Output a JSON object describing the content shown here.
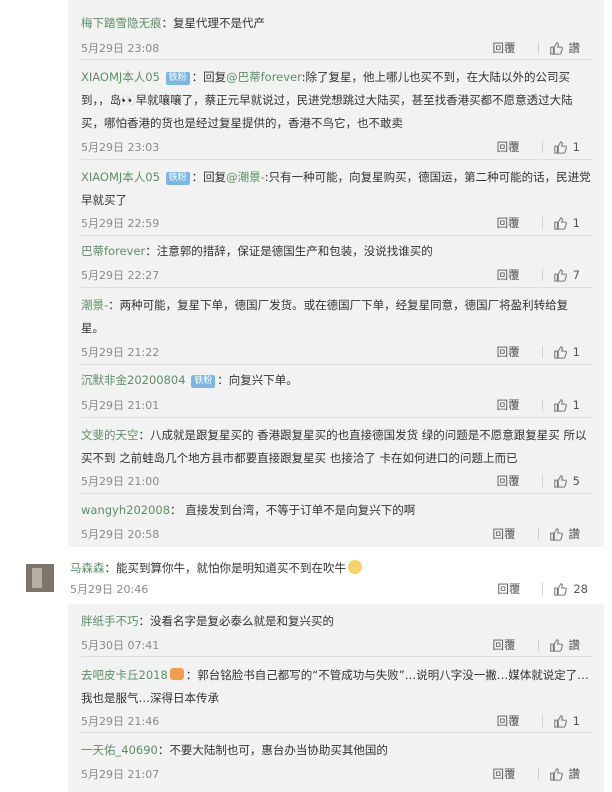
{
  "labels": {
    "reply": "回覆",
    "like": "讚"
  },
  "colors": {
    "username": "#5c8f66",
    "badge": "#7cb7e4",
    "block_bg": "#f2f2f2"
  },
  "icons": {
    "thumb": "thumbs-up-icon",
    "emoji_laugh": "emoji-laugh-icon",
    "emoji_clap": "emoji-clap-icon"
  },
  "replies_a": [
    {
      "user": "梅下踏雪隐无痕",
      "badge": "",
      "mention": "",
      "text": "：复星代理不是代产",
      "time": "5月29日 23:08",
      "likes": "讚"
    },
    {
      "user": "XIAOMJ本人05",
      "badge": "铁粉",
      "mention": "@巴蒂forever",
      "pre": "：回复",
      "text": ":除了复星，他上哪儿也买不到，在大陆以外的公司买到，，岛👀早就嚷嚷了，蔡正元早就说过，民进党想跳过大陆买，甚至找香港买都不愿意透过大陆买，哪怕香港的货也是经过复星提供的，香港不鸟它，也不敢卖",
      "time": "5月29日 23:03",
      "likes": "1"
    },
    {
      "user": "XIAOMJ本人05",
      "badge": "铁粉",
      "mention": "@潮景-",
      "pre": "：回复",
      "text": ":只有一种可能，向复星购买，德国运，第二种可能的话，民进党早就买了",
      "time": "5月29日 22:59",
      "likes": "1"
    },
    {
      "user": "巴蒂forever",
      "badge": "",
      "mention": "",
      "text": "：注意郭的措辞，保证是德国生产和包装，没说找谁买的",
      "time": "5月29日 22:27",
      "likes": "7"
    },
    {
      "user": "潮景-",
      "badge": "",
      "mention": "",
      "text": "：两种可能，复星下单，德国厂发货。或在德国厂下单，经复星同意，德国厂将盈利转给复星。",
      "time": "5月29日 21:22",
      "likes": "1"
    },
    {
      "user": "沉默非金20200804",
      "badge": "铁粉",
      "mention": "",
      "text": "：向复兴下单。",
      "time": "5月29日 21:01",
      "likes": "1"
    },
    {
      "user": "文斐的天空",
      "badge": "",
      "mention": "",
      "text": "：八成就是跟复星买的 香港跟复星买的也直接德国发货 绿的问题是不愿意跟复星买 所以买不到 之前蛙岛几个地方县市都要直接跟复星买 也接洽了 卡在如何进口的问题上而已",
      "time": "5月29日 21:00",
      "likes": "5"
    },
    {
      "user": "wangyh202008",
      "badge": "",
      "mention": "",
      "text": "：  直接发到台湾，不等于订单不是向复兴下的啊",
      "time": "5月29日 20:58",
      "likes": "讚"
    }
  ],
  "main_comment": {
    "user": "马森森",
    "text": "：能买到算你牛，就怕你是明知道买不到在吹牛",
    "time": "5月29日 20:46",
    "likes": "28"
  },
  "replies_b": [
    {
      "user": "胖纸手不巧",
      "text": "：没看名字是复必泰么就是和复兴买的",
      "time": "5月30日 07:41",
      "likes": "讚"
    },
    {
      "user": "去吧皮卡丘2018",
      "text": "：郭台铭脸书自己都写的“不管成功与失败”…说明八字没一撇…媒体就说定了…我也是服气…深得日本传承",
      "time": "5月29日 21:46",
      "likes": "1"
    },
    {
      "user": "一天佑_40690",
      "text": "：不要大陆制也可，惠台办当协助买其他国的",
      "time": "5月29日 21:07",
      "likes": "讚"
    }
  ]
}
